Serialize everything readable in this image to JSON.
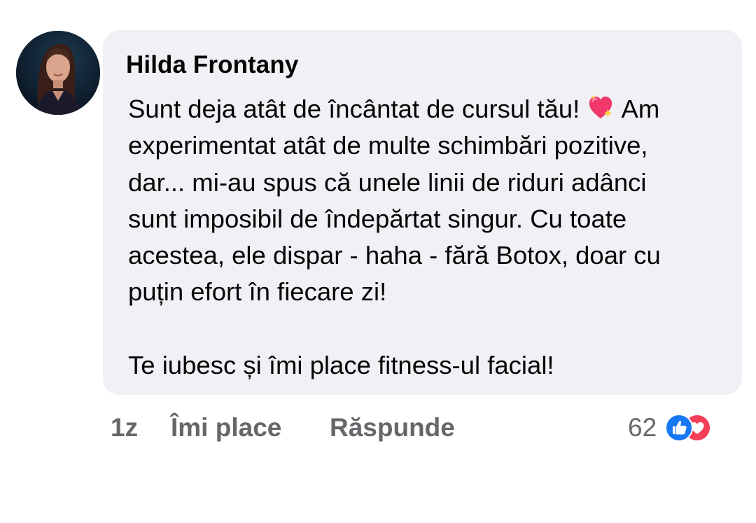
{
  "comment": {
    "author": "Hilda Frontany",
    "text_lines": [
      "Sunt deja atât de încântat de cursul tău! ",
      " Am",
      "experimentat atât de multe schimbări pozitive,",
      "dar... mi-au spus că unele linii de riduri adânci",
      "sunt imposibil de îndepărtat singur. Cu toate",
      "acestea, ele dispar - haha - fără Botox, doar cu",
      "puțin efort în fiecare zi!",
      "Te iubesc și îmi place fitness-ul facial!"
    ],
    "emoji": "sparkling-heart-icon"
  },
  "actions": {
    "time": "1z",
    "like": "Îmi place",
    "reply": "Răspunde"
  },
  "reactions": {
    "count": "62",
    "icons": [
      "like-reaction-icon",
      "love-reaction-icon"
    ]
  },
  "colors": {
    "bubble_bg": "#f0f0f5",
    "text": "#050505",
    "secondary_text": "#65676b",
    "like_blue": "#1877f2",
    "love_red": "#f33e58"
  }
}
